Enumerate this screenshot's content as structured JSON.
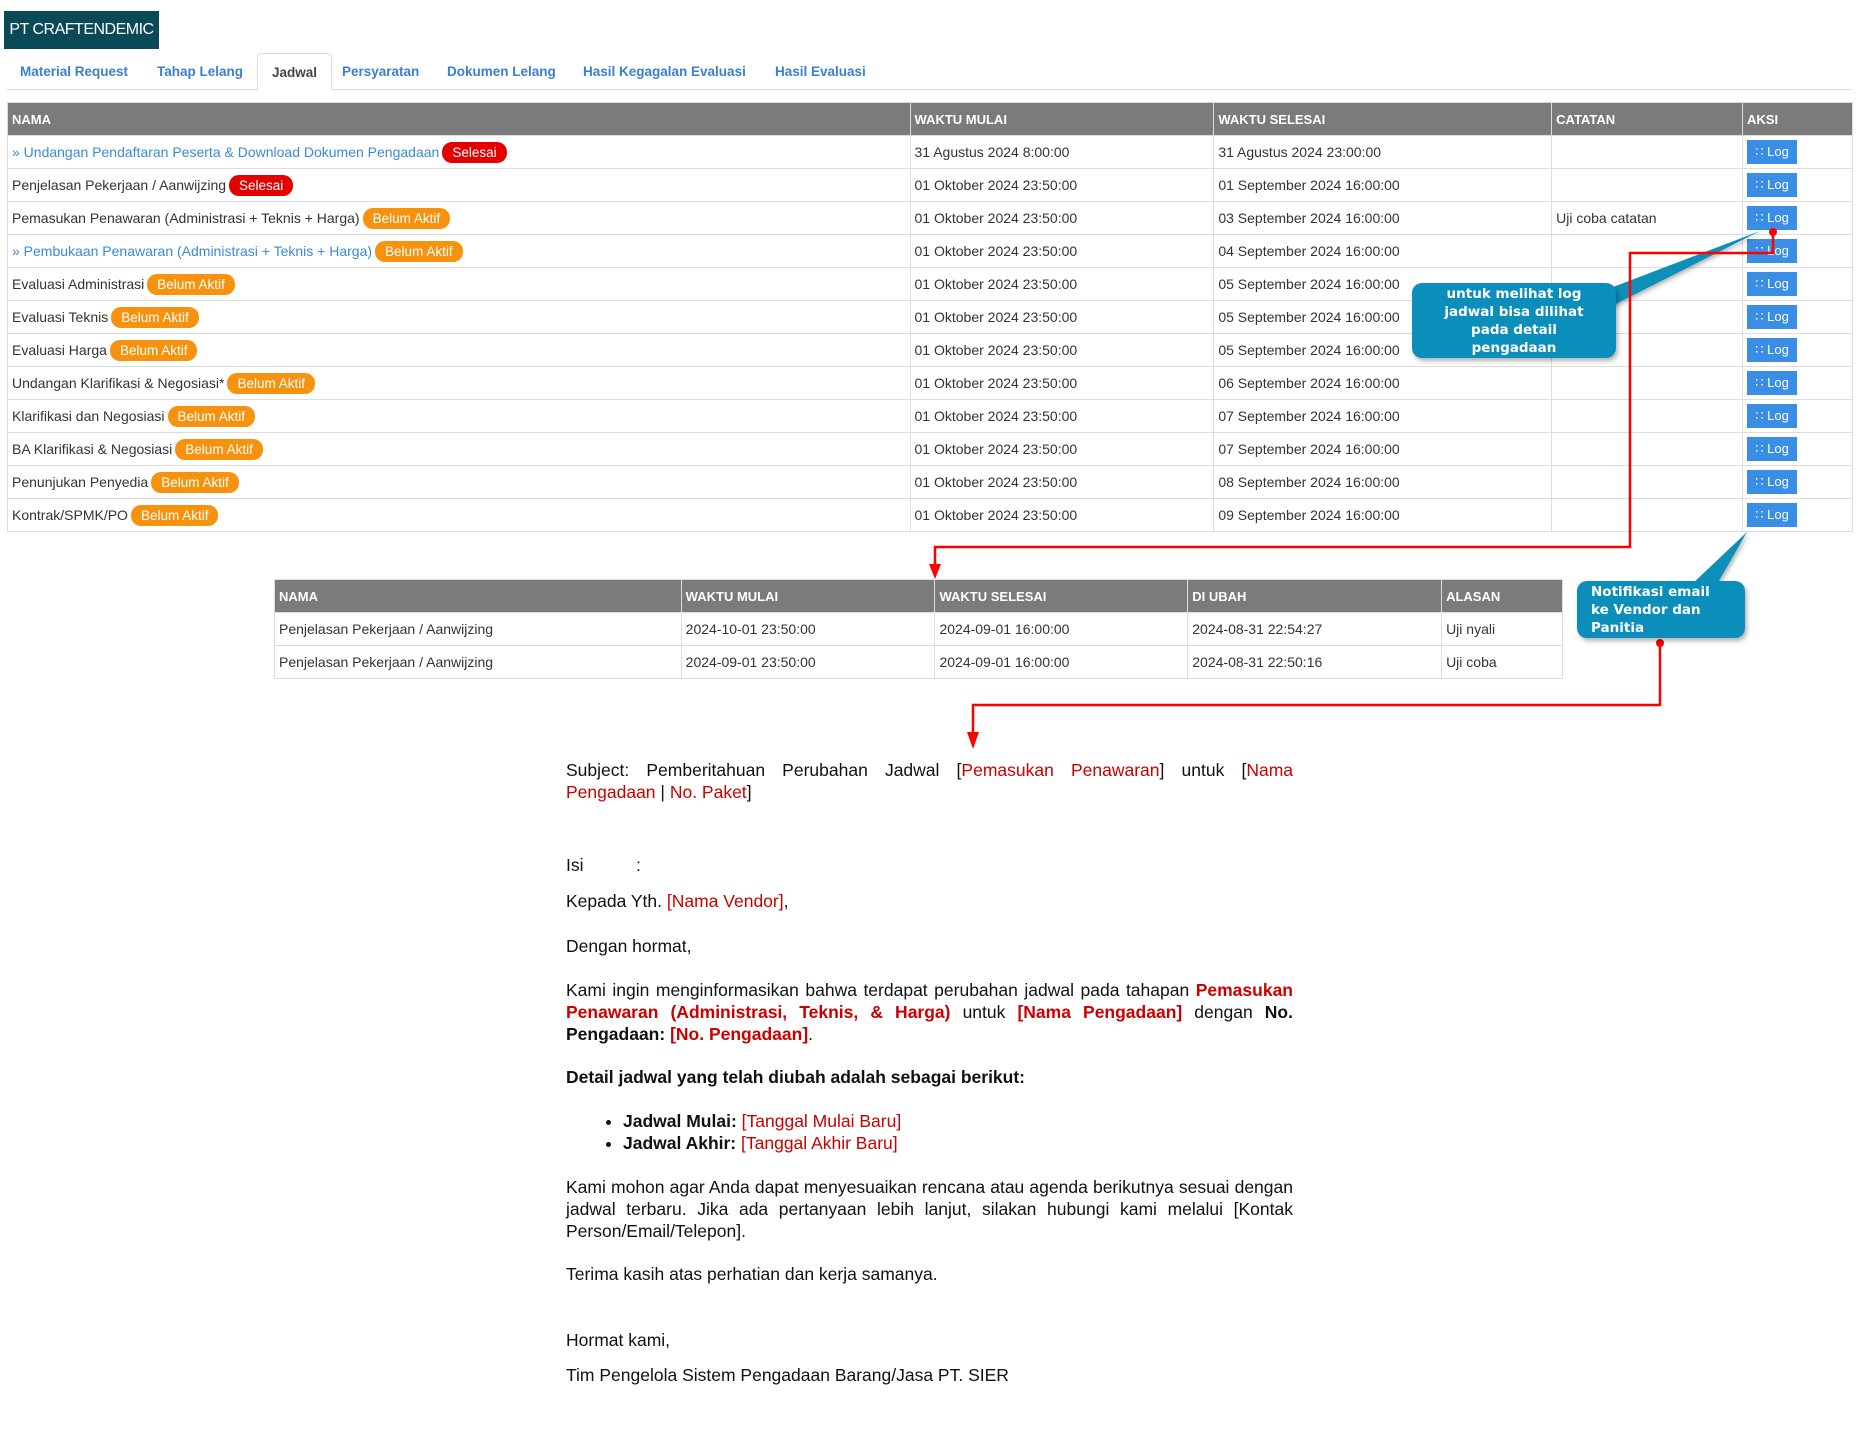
{
  "brand": "PT CRAFTENDEMIC",
  "tabs": [
    "Material Request",
    "Tahap Lelang",
    "Jadwal",
    "Persyaratan",
    "Dokumen Lelang",
    "Hasil Kegagalan Evaluasi",
    "Hasil Evaluasi"
  ],
  "active_tab": "Jadwal",
  "schedule": {
    "headers": [
      "NAMA",
      "WAKTU MULAI",
      "WAKTU SELESAI",
      "CATATAN",
      "AKSI"
    ],
    "log_label": "Log",
    "rows": [
      {
        "name": "» Undangan Pendaftaran Peserta & Download Dokumen Pengadaan",
        "link": true,
        "status": "Selesai",
        "start": "31 Agustus 2024 8:00:00",
        "end": "31 Agustus 2024 23:00:00",
        "note": ""
      },
      {
        "name": "Penjelasan Pekerjaan / Aanwijzing",
        "link": false,
        "status": "Selesai",
        "start": "01 Oktober 2024 23:50:00",
        "end": "01 September 2024 16:00:00",
        "note": ""
      },
      {
        "name": "Pemasukan Penawaran (Administrasi + Teknis + Harga)",
        "link": false,
        "status": "Belum Aktif",
        "start": "01 Oktober 2024 23:50:00",
        "end": "03 September 2024 16:00:00",
        "note": "Uji coba catatan"
      },
      {
        "name": "» Pembukaan Penawaran (Administrasi + Teknis + Harga)",
        "link": true,
        "status": "Belum Aktif",
        "start": "01 Oktober 2024 23:50:00",
        "end": "04 September 2024 16:00:00",
        "note": ""
      },
      {
        "name": "Evaluasi Administrasi",
        "link": false,
        "status": "Belum Aktif",
        "start": "01 Oktober 2024 23:50:00",
        "end": "05 September 2024 16:00:00",
        "note": ""
      },
      {
        "name": "Evaluasi Teknis",
        "link": false,
        "status": "Belum Aktif",
        "start": "01 Oktober 2024 23:50:00",
        "end": "05 September 2024 16:00:00",
        "note": ""
      },
      {
        "name": "Evaluasi Harga",
        "link": false,
        "status": "Belum Aktif",
        "start": "01 Oktober 2024 23:50:00",
        "end": "05 September 2024 16:00:00",
        "note": ""
      },
      {
        "name": "Undangan Klarifikasi & Negosiasi*",
        "link": false,
        "status": "Belum Aktif",
        "start": "01 Oktober 2024 23:50:00",
        "end": "06 September 2024 16:00:00",
        "note": ""
      },
      {
        "name": "Klarifikasi dan Negosiasi",
        "link": false,
        "status": "Belum Aktif",
        "start": "01 Oktober 2024 23:50:00",
        "end": "07 September 2024 16:00:00",
        "note": ""
      },
      {
        "name": "BA Klarifikasi & Negosiasi",
        "link": false,
        "status": "Belum Aktif",
        "start": "01 Oktober 2024 23:50:00",
        "end": "07 September 2024 16:00:00",
        "note": ""
      },
      {
        "name": "Penunjukan Penyedia",
        "link": false,
        "status": "Belum Aktif",
        "start": "01 Oktober 2024 23:50:00",
        "end": "08 September 2024 16:00:00",
        "note": ""
      },
      {
        "name": "Kontrak/SPMK/PO",
        "link": false,
        "status": "Belum Aktif",
        "start": "01 Oktober 2024 23:50:00",
        "end": "09 September 2024 16:00:00",
        "note": ""
      }
    ]
  },
  "log_table": {
    "headers": [
      "NAMA",
      "WAKTU MULAI",
      "WAKTU SELESAI",
      "DI UBAH",
      "ALASAN"
    ],
    "rows": [
      [
        "Penjelasan Pekerjaan / Aanwijzing",
        "2024-10-01 23:50:00",
        "2024-09-01 16:00:00",
        "2024-08-31 22:54:27",
        "Uji nyali"
      ],
      [
        "Penjelasan Pekerjaan / Aanwijzing",
        "2024-09-01 23:50:00",
        "2024-09-01 16:00:00",
        "2024-08-31 22:50:16",
        "Uji coba"
      ]
    ]
  },
  "callouts": {
    "log": "untuk melihat log jadwal bisa dilihat pada detail pengadaan",
    "notif": "Notifikasi email ke Vendor dan Panitia"
  },
  "email": {
    "subject_prefix": "Subject: Pemberitahuan Perubahan Jadwal [",
    "subject_stage": "Pemasukan Penawaran",
    "subject_mid": "] untuk [",
    "subject_name": "Nama Pengadaan",
    "subject_sep": " | ",
    "subject_paket": "No. Paket",
    "subject_end": "]",
    "isi_label": "Isi",
    "isi_colon": ":",
    "greeting_prefix": "Kepada Yth. ",
    "greeting_vendor": "[Nama Vendor]",
    "greeting_end": ",",
    "salutation": "Dengan hormat,",
    "intro_1": "Kami ingin menginformasikan bahwa terdapat perubahan jadwal pada tahapan ",
    "intro_stage": "Pemasukan Penawaran (Administrasi, Teknis, & Harga)",
    "intro_2": " untuk ",
    "intro_name": "[Nama Pengadaan]",
    "intro_3": " dengan ",
    "intro_no_label": "No. Pengadaan:",
    "intro_no": "[No. Pengadaan]",
    "intro_end": ".",
    "detail_heading": "Detail jadwal yang telah diubah adalah sebagai berikut:",
    "bullets": [
      {
        "label": "Jadwal Mulai:",
        "value": "[Tanggal Mulai Baru]"
      },
      {
        "label": "Jadwal Akhir:",
        "value": "[Tanggal Akhir Baru]"
      }
    ],
    "request": "Kami mohon agar Anda dapat menyesuaikan rencana atau agenda berikutnya sesuai dengan jadwal terbaru. Jika ada pertanyaan lebih lanjut, silakan hubungi kami melalui [Kontak Person/Email/Telepon].",
    "thanks": "Terima kasih atas perhatian dan kerja samanya.",
    "closing": "Hormat kami,",
    "signature": "Tim Pengelola Sistem Pengadaan Barang/Jasa PT. SIER"
  },
  "colors": {
    "header": "#7b7b7b",
    "brand": "#0a4a58",
    "done": "#e30000",
    "pending": "#f7920f",
    "button": "#3a8ee6",
    "callout": "#0b8fba",
    "connector": "#ff0000"
  }
}
